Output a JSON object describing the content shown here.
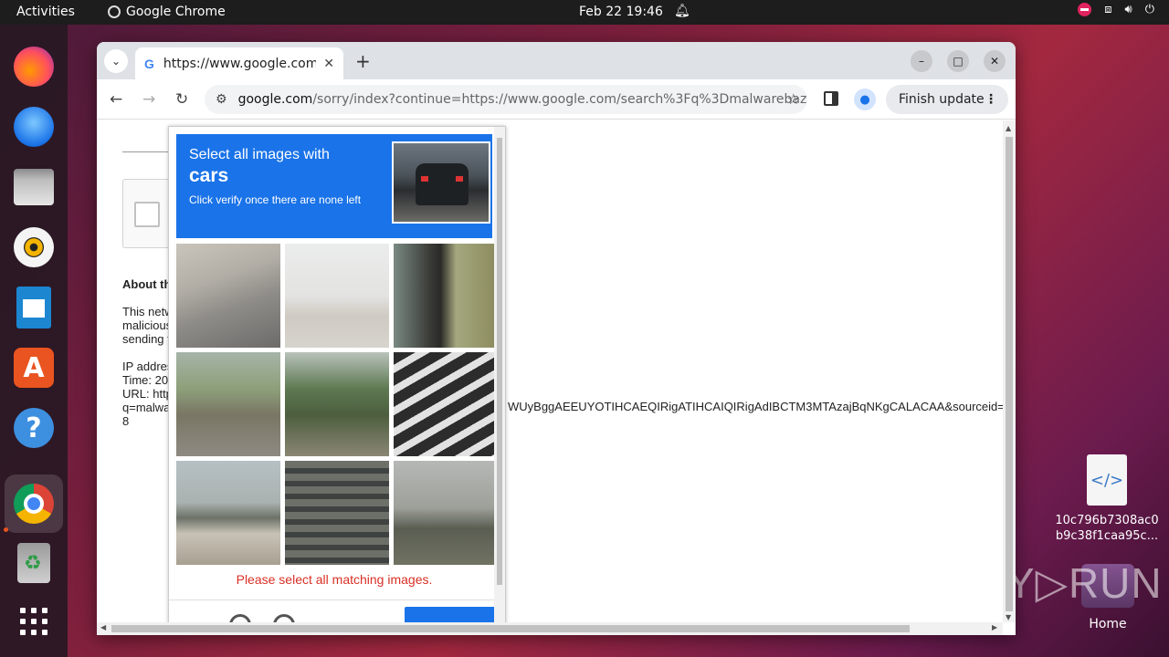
{
  "topbar": {
    "activities": "Activities",
    "app_name": "Google Chrome",
    "clock": "Feb 22  19:46"
  },
  "dock": {
    "items": [
      "firefox-icon",
      "thunderbird-icon",
      "files-icon",
      "rhythmbox-icon",
      "libreoffice-writer-icon",
      "app-center-icon",
      "help-icon",
      "chrome-icon",
      "trash-icon",
      "show-apps-icon"
    ]
  },
  "desktop": {
    "file_name": "10c796b7308ac0\nb9c38f1caa95c...",
    "home_label": "Home",
    "watermark": "ANY▷RUN"
  },
  "browser": {
    "tab_title": "https://www.google.com",
    "url_host": "google.com",
    "url_path": "/sorry/index?continue=https://www.google.com/search%3Fq%3Dmalwarebaz...",
    "finish_update": "Finish update"
  },
  "page": {
    "about_heading": "About th",
    "body_lines": [
      "This netw",
      "malicious",
      "sending t"
    ],
    "ip_line": "IP addres",
    "time_line": "Time: 20",
    "url_line": "URL: http",
    "q_line": "q=malwa",
    "num_line": "8",
    "long_url_fragment": "WUyBggAEEUYOTIHCAEQIRigATIHCAIQIRigAdIBCTM3MTAzajBqNKgCALACAA&sourceid=c"
  },
  "captcha": {
    "instruction_1": "Select all images with",
    "target": "cars",
    "instruction_2": "Click verify once there are none left",
    "error": "Please select all matching images.",
    "accent": "#1a73e8",
    "error_color": "#d93025"
  }
}
